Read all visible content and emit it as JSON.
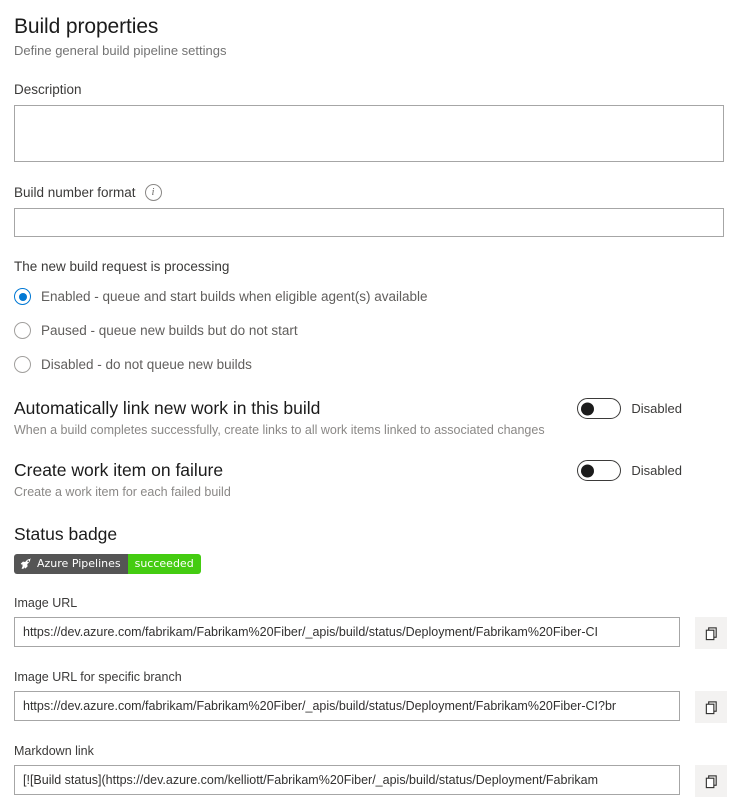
{
  "header": {
    "title": "Build properties",
    "subtitle": "Define general build pipeline settings"
  },
  "description": {
    "label": "Description",
    "value": "",
    "placeholder": ""
  },
  "build_number_format": {
    "label": "Build number format",
    "info_icon": "info-icon",
    "value": "",
    "placeholder": ""
  },
  "processing": {
    "label": "The new build request is processing",
    "selected_index": 0,
    "options": [
      {
        "label": "Enabled - queue and start builds when eligible agent(s) available"
      },
      {
        "label": "Paused - queue new builds but do not start"
      },
      {
        "label": "Disabled - do not queue new builds"
      }
    ]
  },
  "auto_link": {
    "heading": "Automatically link new work in this build",
    "description": "When a build completes successfully, create links to all work items linked to associated changes",
    "toggle_state": "Disabled"
  },
  "create_work_item": {
    "heading": "Create work item on failure",
    "description": "Create a work item for each failed build",
    "toggle_state": "Disabled"
  },
  "status_badge": {
    "heading": "Status badge",
    "icon": "rocket-icon",
    "left_text": "Azure Pipelines",
    "right_text": "succeeded",
    "left_color": "#555555",
    "right_color": "#44cc11"
  },
  "image_url": {
    "label": "Image URL",
    "value": "https://dev.azure.com/fabrikam/Fabrikam%20Fiber/_apis/build/status/Deployment/Fabrikam%20Fiber-CI",
    "copy_icon": "copy-icon"
  },
  "image_url_branch": {
    "label": "Image URL for specific branch",
    "value": "https://dev.azure.com/fabrikam/Fabrikam%20Fiber/_apis/build/status/Deployment/Fabrikam%20Fiber-CI?br",
    "copy_icon": "copy-icon"
  },
  "markdown_link": {
    "label": "Markdown link",
    "value": "[![Build status](https://dev.azure.com/kelliott/Fabrikam%20Fiber/_apis/build/status/Deployment/Fabrikam",
    "copy_icon": "copy-icon"
  },
  "colors": {
    "accent": "#0078d4",
    "text": "#323130",
    "muted": "#8a8886",
    "border": "#a6a6a6"
  }
}
